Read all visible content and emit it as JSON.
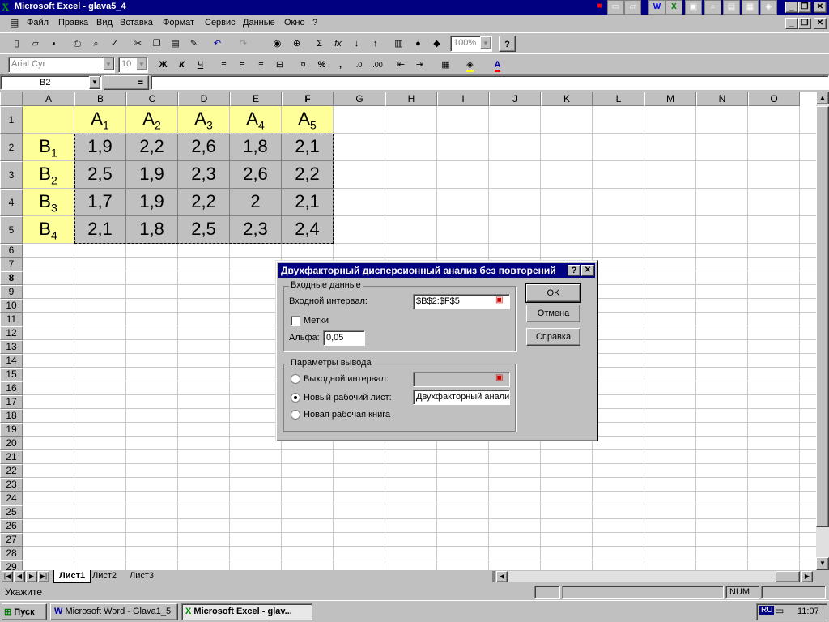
{
  "window": {
    "title": "Microsoft Excel - glava5_4"
  },
  "menubar": {
    "items": [
      "Файл",
      "Правка",
      "Вид",
      "Вставка",
      "Формат",
      "Сервис",
      "Данные",
      "Окно",
      "?"
    ]
  },
  "toolbar_standard": {
    "zoom": "100%"
  },
  "toolbar_format": {
    "font": "Arial Cyr",
    "size": "10",
    "bold": "Ж",
    "italic": "К",
    "underline": "Ч",
    "percent": "%",
    "comma": ","
  },
  "formula_bar": {
    "name_box": "B2",
    "equals": "="
  },
  "sheet": {
    "columns": [
      "A",
      "B",
      "C",
      "D",
      "E",
      "F",
      "G",
      "H",
      "I",
      "J",
      "K",
      "L",
      "M",
      "N",
      "O"
    ],
    "rows": [
      "1",
      "2",
      "3",
      "4",
      "5",
      "6",
      "7",
      "8",
      "9",
      "10",
      "11",
      "12",
      "13",
      "14",
      "15",
      "16",
      "17",
      "18",
      "19",
      "20",
      "21",
      "22",
      "23",
      "24",
      "25",
      "26",
      "27",
      "28",
      "29"
    ],
    "header_row": [
      {
        "m": "A",
        "s": "1"
      },
      {
        "m": "A",
        "s": "2"
      },
      {
        "m": "A",
        "s": "3"
      },
      {
        "m": "A",
        "s": "4"
      },
      {
        "m": "A",
        "s": "5"
      }
    ],
    "row_labels": [
      {
        "m": "B",
        "s": "1"
      },
      {
        "m": "B",
        "s": "2"
      },
      {
        "m": "B",
        "s": "3"
      },
      {
        "m": "B",
        "s": "4"
      }
    ],
    "values": [
      [
        "1,9",
        "2,2",
        "2,6",
        "1,8",
        "2,1"
      ],
      [
        "2,5",
        "1,9",
        "2,3",
        "2,6",
        "2,2"
      ],
      [
        "1,7",
        "1,9",
        "2,2",
        "2",
        "2,1"
      ],
      [
        "2,1",
        "1,8",
        "2,5",
        "2,3",
        "2,4"
      ]
    ]
  },
  "sheet_tabs": [
    "Лист1",
    "Лист2",
    "Лист3"
  ],
  "status": {
    "text": "Укажите",
    "num": "NUM"
  },
  "taskbar": {
    "start": "Пуск",
    "task1": "Microsoft Word - Glava1_5",
    "task2": "Microsoft Excel - glav...",
    "lang": "RU",
    "clock": "11:07"
  },
  "dialog": {
    "title": "Двухфакторный дисперсионный анализ без повторений",
    "help": "?",
    "close": "✕",
    "input_group": "Входные данные",
    "input_range_label": "Входной интервал:",
    "input_range_value": "$B$2:$F$5",
    "labels_checkbox": "Метки",
    "alpha_label": "Альфа:",
    "alpha_value": "0,05",
    "output_group": "Параметры вывода",
    "output_range_label": "Выходной интервал:",
    "output_range_value": "",
    "new_sheet_label": "Новый рабочий лист:",
    "new_sheet_value": "Двухфакторный анализ",
    "new_book_label": "Новая рабочая книга",
    "ok": "OK",
    "cancel": "Отмена",
    "help_button": "Справка"
  },
  "colors": {
    "title_bar": "#000080",
    "header_fill": "#ffff99",
    "data_fill": "#c0c0c0"
  }
}
